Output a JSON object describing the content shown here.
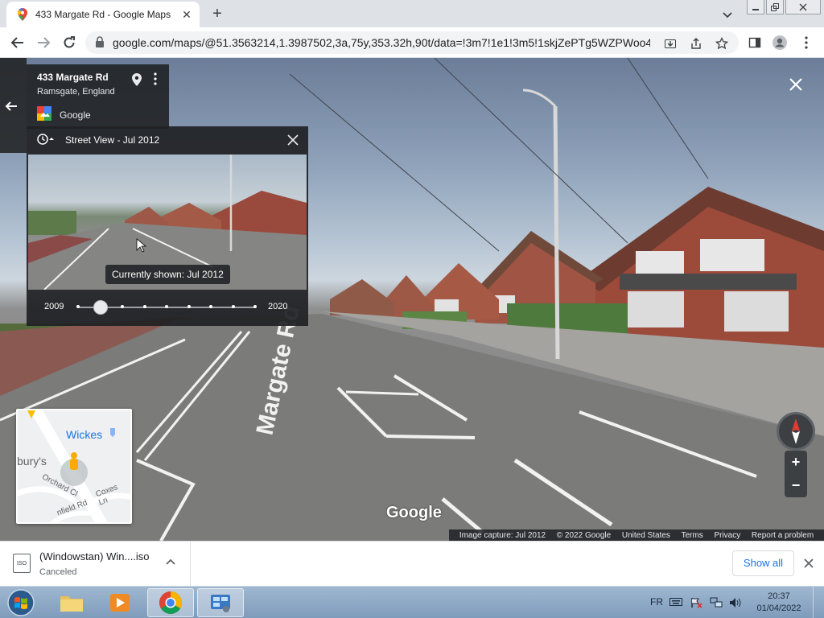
{
  "browser": {
    "tab_title": "433 Margate Rd - Google Maps",
    "url": "google.com/maps/@51.3563214,1.3987502,3a,75y,353.32h,90t/data=!3m7!1e1!3m5!1skjZePTg5WZPWoo4...",
    "window_controls": [
      "minimize",
      "restore",
      "close"
    ]
  },
  "place_card": {
    "address": "433 Margate Rd",
    "locality": "Ramsgate, England",
    "brand": "Google"
  },
  "time_machine": {
    "header": "Street View - Jul 2012",
    "current_label": "Currently shown: Jul 2012",
    "year_start": "2009",
    "year_end": "2020",
    "tick_count": 9,
    "selected_index": 1
  },
  "street_view": {
    "road_label": "Margate Rd",
    "watermark": "Google"
  },
  "minimap": {
    "labels": [
      "Wickes",
      "bury's",
      "Orchard Cl",
      "Coxes Ln",
      "nfield Rd"
    ]
  },
  "footer": {
    "capture": "Image capture: Jul 2012",
    "copyright": "© 2022 Google",
    "country": "United States",
    "terms": "Terms",
    "privacy": "Privacy",
    "report": "Report a problem"
  },
  "controls": {
    "zoom_in": "+",
    "zoom_out": "−"
  },
  "downloads": {
    "file_name": "(Windowstan) Win....iso",
    "status": "Canceled",
    "file_type": "ISO",
    "show_all": "Show all"
  },
  "taskbar": {
    "language": "FR",
    "time": "20:37",
    "date": "01/04/2022"
  },
  "colors": {
    "accent_blue": "#1a73e8",
    "panel_dark": "#202124"
  }
}
